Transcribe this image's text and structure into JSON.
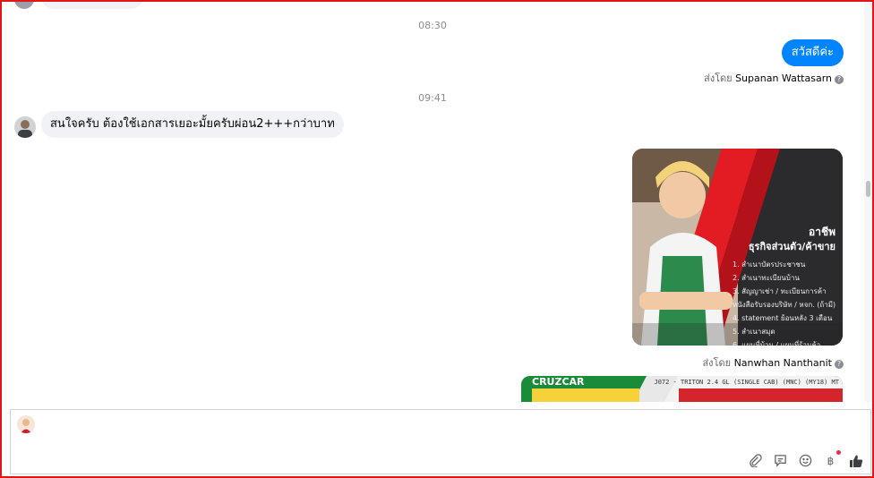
{
  "messages": {
    "ts1": "08:30",
    "ts2": "09:41",
    "outgoing_text": "สวัสดีค่ะ",
    "sent_by_prefix": "ส่งโดย",
    "sender1": "Supanan Wattasarn",
    "incoming_text": "สนใจครับ ต้องใช้เอกสารเยอะมั้ยครับผ่อน2+++กว่าบาท",
    "sender2": "Nanwhan Nanthanit",
    "help_glyph": "?"
  },
  "image_card": {
    "heading1": "อาชีพ",
    "heading2": "ธุรกิจส่วนตัว/ค้าขาย",
    "items": [
      "1. สำเนาบัตรประชาชน",
      "2. สำเนาทะเบียนบ้าน",
      "3. สัญญาเช่า / ทะเบียนการค้า",
      "หนังสือรับรองบริษัท / หจก. (ถ้ามี)",
      "4. statement ย้อนหลัง 3 เดือน",
      "5. สำเนาสมุด",
      "6. แผนที่บ้าน / แผนที่ร้านค้า"
    ]
  },
  "image_card2": {
    "banner": "CRUZCAR",
    "model_text": "J072 - TRITON 2.4 GL (SINGLE CAB) (MNC) (MY18) MT"
  },
  "composer": {
    "icons": [
      "paperclip-icon",
      "sticker-icon",
      "emoji-icon",
      "baht-icon",
      "thumbs-up-icon"
    ],
    "baht_glyph": "฿"
  },
  "colors": {
    "accent": "#0084ff",
    "frame": "#e4141b",
    "bubble_in": "#f0f2f5"
  }
}
